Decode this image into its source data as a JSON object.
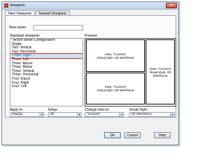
{
  "window": {
    "title": "Viewports",
    "close_glyph": "✕"
  },
  "tabs": [
    {
      "label": "New Viewports",
      "active": true
    },
    {
      "label": "Named Viewports",
      "active": false
    }
  ],
  "new_name": {
    "label": "New name:",
    "value": ""
  },
  "standard_viewports": {
    "label": "Standard viewports:",
    "items": [
      "*Active Model Configuration*",
      "Single",
      "Two: Vertical",
      "Two: Horizontal",
      "Three: Right",
      "Three: Left",
      "Three: Above",
      "Three: Below",
      "Three: Vertical",
      "Three: Horizontal",
      "Four: Equal",
      "Four: Right",
      "Four: Left"
    ],
    "selected_index": 4
  },
  "preview": {
    "label": "Preview",
    "viewports": [
      {
        "view": "View: *Current*",
        "style": "Visual style: 2D Wireframe"
      },
      {
        "view": "View: *Current*",
        "style": "Visual style: 2D Wireframe"
      },
      {
        "view": "View: *Current*",
        "style": "Visual style: 2D Wireframe"
      }
    ]
  },
  "apply_to": {
    "label": "Apply to:",
    "value": "Display"
  },
  "setup": {
    "label": "Setup:",
    "value": "2D"
  },
  "change_view": {
    "label": "Change view to:",
    "value": "*Current*"
  },
  "visual_style": {
    "label": "Visual Style:",
    "value": "2D Wireframe"
  },
  "buttons": {
    "ok": "OK",
    "cancel": "Cancel",
    "help": "Help"
  }
}
